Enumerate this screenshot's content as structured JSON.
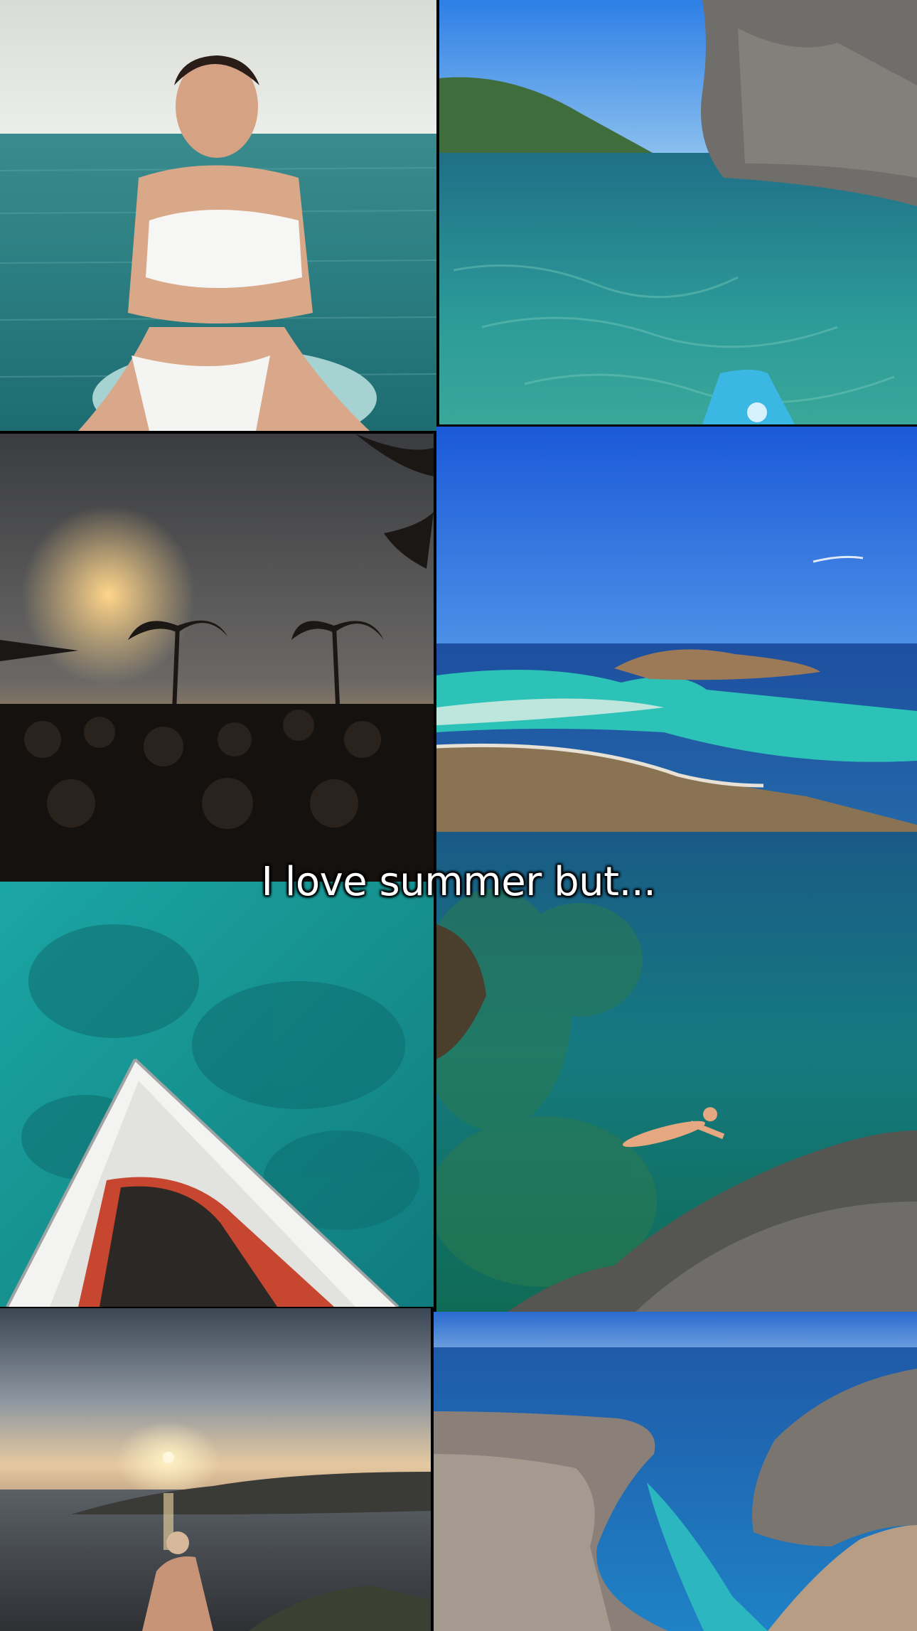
{
  "caption": "I love summer but...",
  "tiles": [
    {
      "name": "woman-on-paddleboard-photo"
    },
    {
      "name": "kayak-clear-water-cliff-photo"
    },
    {
      "name": "sunset-palm-party-photo"
    },
    {
      "name": "lagoon-bay-aerial-photo"
    },
    {
      "name": "boat-bow-turquoise-water-photo"
    },
    {
      "name": "swimmer-floating-cliff-photo"
    },
    {
      "name": "sunset-sea-woman-photo"
    },
    {
      "name": "canyon-cove-beach-photo"
    }
  ],
  "colors": {
    "sea_teal": "#1f7d86",
    "sky_blue": "#1f5fd6",
    "turquoise": "#29b6b0",
    "sunset": "#f3c98a"
  }
}
